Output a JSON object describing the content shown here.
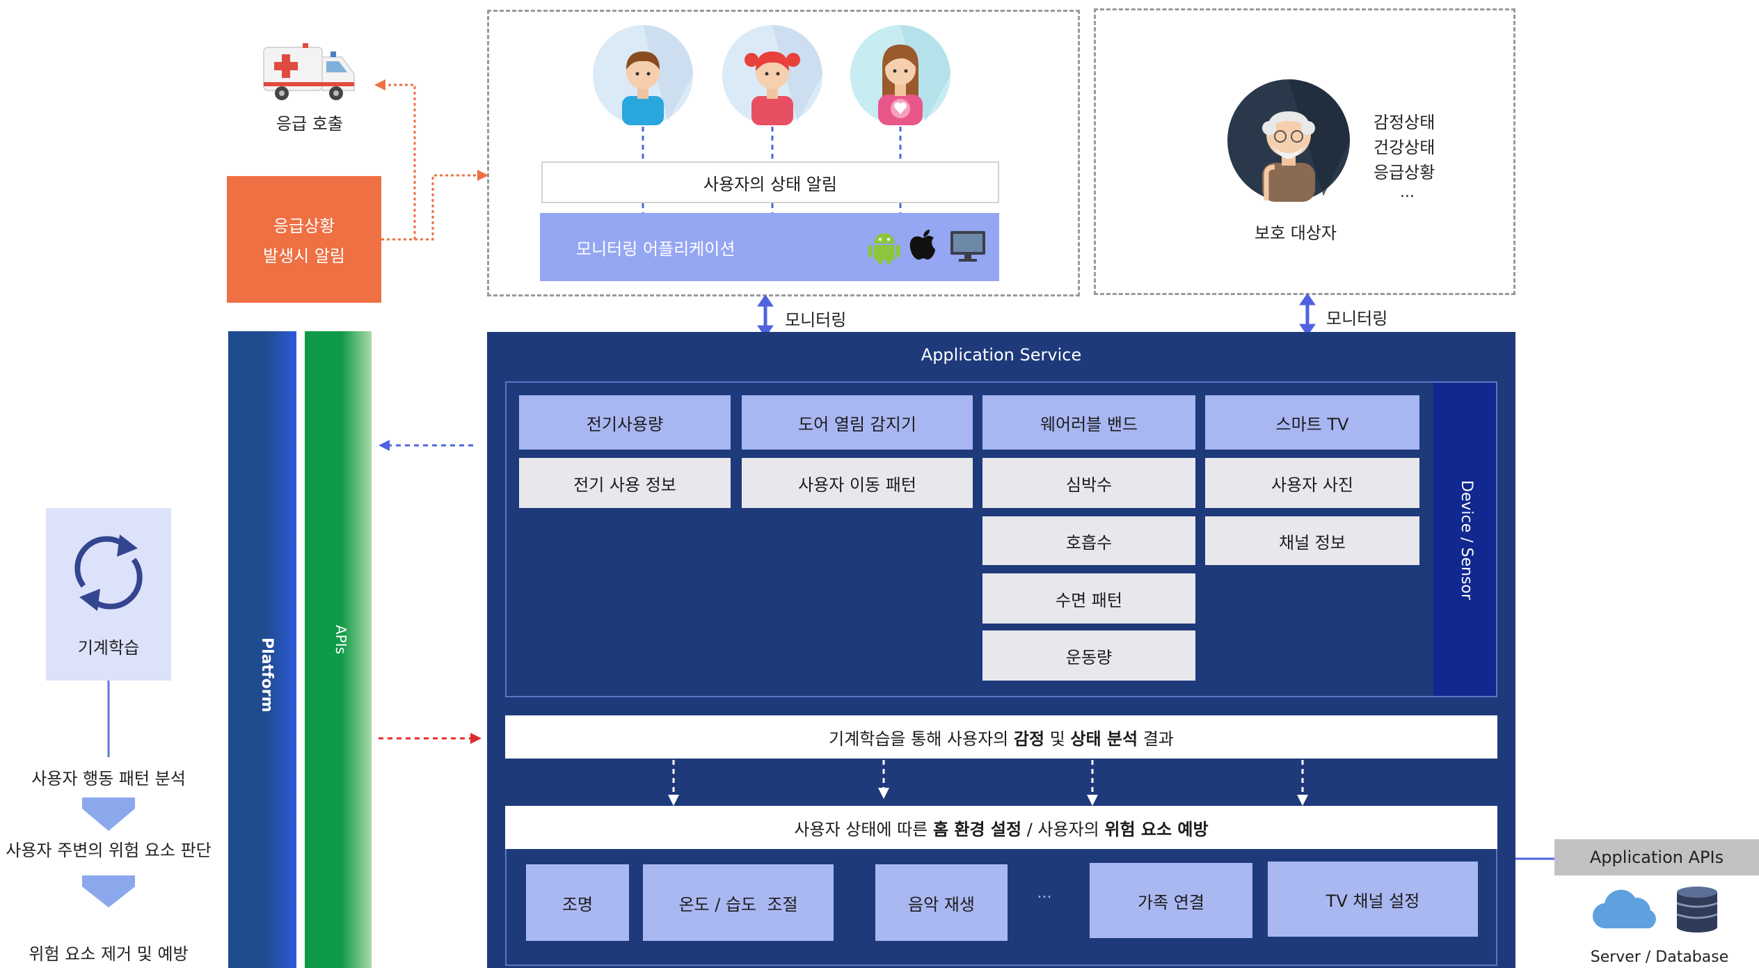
{
  "emergency": {
    "call_label": "응급 호출",
    "alert_line1": "응급상황",
    "alert_line2": "발생시 알림"
  },
  "monitor_app": {
    "status_notice": "사용자의 상태 알림",
    "app_label": "모니터링 어플리케이션"
  },
  "protected": {
    "label": "보호 대상자",
    "states": [
      "감정상태",
      "건강상태",
      "응급상황",
      "..."
    ]
  },
  "monitoring_labels": [
    "모니터링",
    "모니터링"
  ],
  "app_service": {
    "title": "Application Service",
    "device_sensor": "Device / Sensor",
    "devices": [
      "전기사용량",
      "도어 열림 감지기",
      "웨어러블 밴드",
      "스마트 TV"
    ],
    "col1": [
      "전기 사용 정보"
    ],
    "col2": [
      "사용자 이동 패턴"
    ],
    "col3": [
      "심박수",
      "호흡수",
      "수면 패턴",
      "운동량"
    ],
    "col4": [
      "사용자 사진",
      "채널 정보"
    ],
    "analysis": {
      "pre": "기계학습을 통해 사용자의 ",
      "b1": "감정",
      "mid": " 및 ",
      "b2": "상태 분석",
      "post": " 결과"
    },
    "settings": {
      "pre": "사용자 상태에 따른 ",
      "b1": "홈 환경 설정",
      "mid": " / 사용자의 ",
      "b2": "위험 요소 예방"
    },
    "actions": [
      "조명",
      "온도 / 습도  조절",
      "음악 재생",
      "...",
      "가족 연결",
      "TV 채널 설정"
    ]
  },
  "platform": {
    "label": "Platform"
  },
  "apis": {
    "label": "APIs"
  },
  "ml": {
    "label": "기계학습",
    "steps": [
      "사용자 행동 패턴 분석",
      "사용자 주변의 위험 요소 판단",
      "위험 요소 제거 및 예방"
    ]
  },
  "app_apis": {
    "label": "Application APIs",
    "server_label": "Server / Database"
  },
  "colors": {
    "navy": "#1e3a7b",
    "emergency_orange": "#ee7043",
    "platform_blue": "#1f4b8f",
    "apis_green": "#0e9a47",
    "arrow_blue": "#4f63e0",
    "arrow_red": "#e02b2b"
  }
}
